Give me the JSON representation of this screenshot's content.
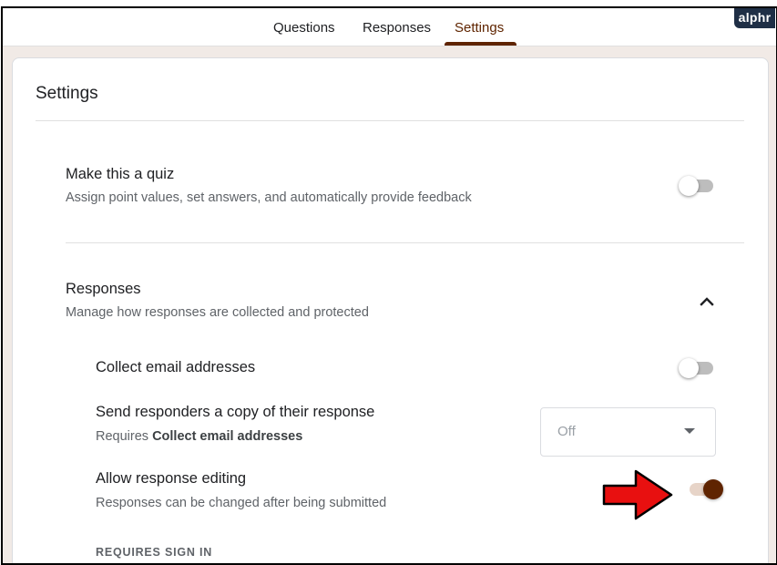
{
  "brand": {
    "logo_text": "alphr"
  },
  "tabs": [
    {
      "label": "Questions",
      "active": false
    },
    {
      "label": "Responses",
      "active": false
    },
    {
      "label": "Settings",
      "active": true
    }
  ],
  "settings": {
    "title": "Settings",
    "quiz": {
      "title": "Make this a quiz",
      "description": "Assign point values, set answers, and automatically provide feedback",
      "enabled": false
    },
    "responses": {
      "title": "Responses",
      "description": "Manage how responses are collected and protected",
      "expanded": true,
      "collect_email": {
        "label": "Collect email addresses",
        "enabled": false
      },
      "send_copy": {
        "label": "Send responders a copy of their response",
        "requires_prefix": "Requires",
        "requires_bold": "Collect email addresses",
        "select_value": "Off"
      },
      "allow_editing": {
        "label": "Allow response editing",
        "description": "Responses can be changed after being submitted",
        "enabled": true
      },
      "requires_sign_in": "REQUIRES SIGN IN"
    }
  },
  "colors": {
    "accent": "#5f2400",
    "annotation_arrow": "#e81010",
    "background": "#f1eae6"
  },
  "icons": {
    "expand": "chevron-up-icon",
    "dropdown": "caret-down-icon",
    "annotation": "red-arrow-icon"
  }
}
